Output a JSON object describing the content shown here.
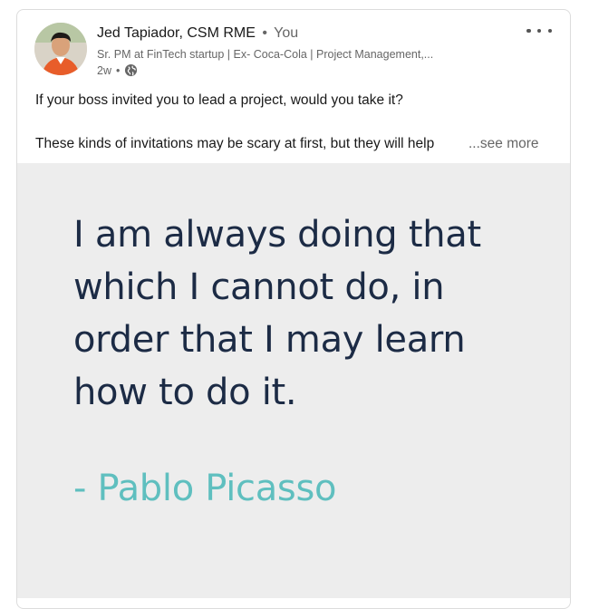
{
  "author": {
    "name": "Jed Tapiador, CSM RME",
    "separator": "•",
    "relation": "You",
    "headline": "Sr. PM at FinTech startup | Ex- Coca-Cola | Project Management,...",
    "time": "2w",
    "meta_dot": "•",
    "visibility_icon": "globe-icon"
  },
  "post": {
    "line1": "If your boss invited you to lead a project, would you take it?",
    "line2": "These kinds of invitations may be scary at first, but they will help",
    "see_more": "...see more"
  },
  "quote": {
    "text": "I am always doing that which I cannot do, in order that I may learn how to do it.",
    "author": "- Pablo Picasso"
  },
  "colors": {
    "quote_text": "#1c2b45",
    "quote_author": "#5fbfbf",
    "quote_background": "#ededed"
  }
}
